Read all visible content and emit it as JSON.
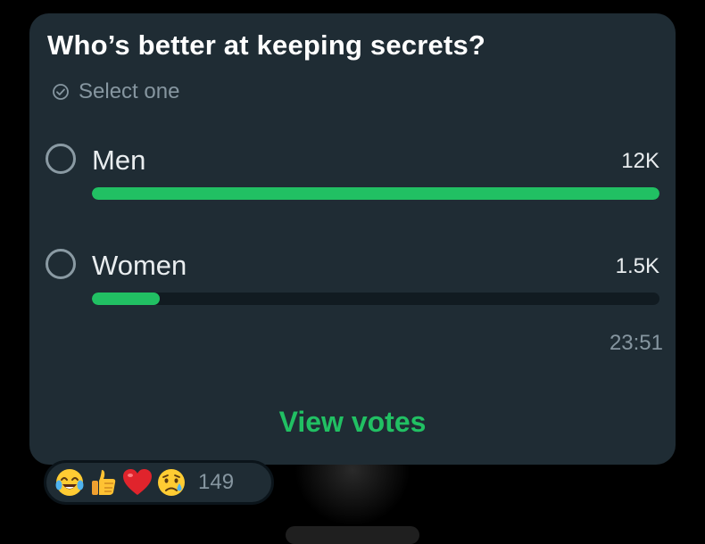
{
  "poll": {
    "question": "Who’s better at keeping secrets?",
    "hint": "Select one",
    "hint_icon": "check-circle-icon",
    "options": [
      {
        "label": "Men",
        "count": "12K",
        "fraction": 1.0
      },
      {
        "label": "Women",
        "count": "1.5K",
        "fraction": 0.12
      }
    ],
    "time": "23:51",
    "view_votes": "View votes"
  },
  "reactions": {
    "emojis": [
      "tears-of-joy-emoji-icon",
      "thumbs-up-emoji-icon",
      "red-heart-emoji-icon",
      "crying-face-emoji-icon"
    ],
    "count": "149"
  },
  "colors": {
    "card": "#1f2c34",
    "accent": "#21c063",
    "track": "#111b21",
    "muted": "#8696a0"
  }
}
